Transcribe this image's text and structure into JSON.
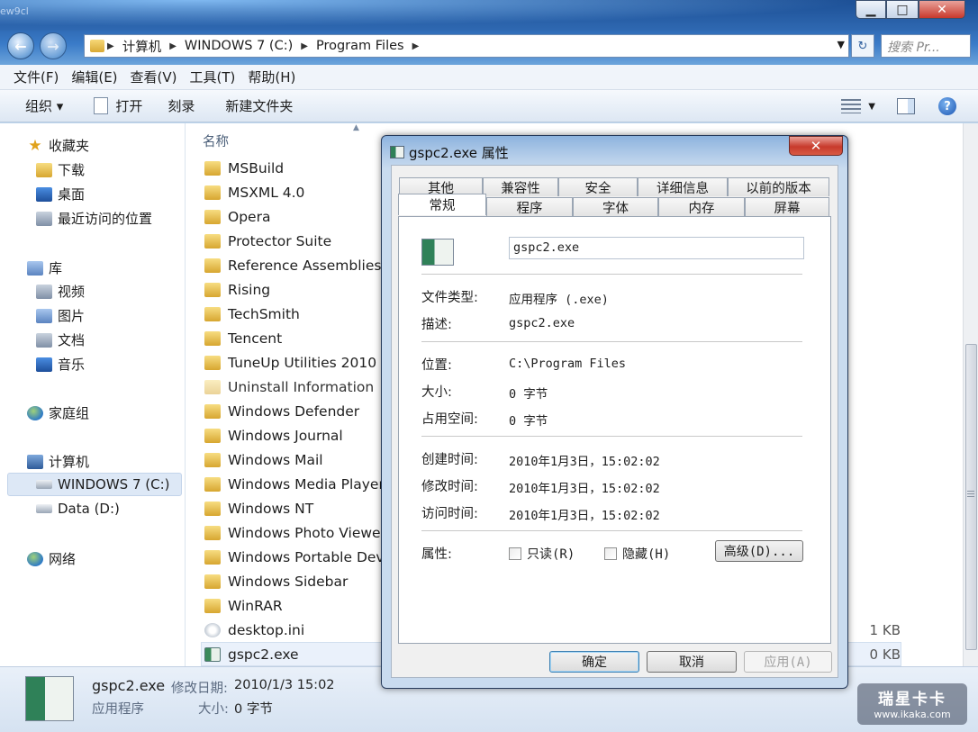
{
  "explorer": {
    "corner_text": "ew9cl",
    "caption": {
      "minimize": "▁",
      "maximize": "□",
      "close": "✕"
    },
    "breadcrumb": [
      "计算机",
      "WINDOWS 7 (C:)",
      "Program Files"
    ],
    "search_placeholder": "搜索 Pr...",
    "menu": [
      "文件(F)",
      "编辑(E)",
      "查看(V)",
      "工具(T)",
      "帮助(H)"
    ],
    "toolbar": {
      "organize": "组织 ▾",
      "open": "打开",
      "burn": "刻录",
      "new_folder": "新建文件夹",
      "help": "?"
    },
    "nav": {
      "favorites": "收藏夹",
      "downloads": "下载",
      "desktop": "桌面",
      "recent": "最近访问的位置",
      "libraries": "库",
      "videos": "视频",
      "pictures": "图片",
      "documents": "文档",
      "music": "音乐",
      "homegroup": "家庭组",
      "computer": "计算机",
      "drive_c": "WINDOWS 7 (C:)",
      "drive_d": "Data (D:)",
      "network": "网络"
    },
    "column_name": "名称",
    "files": [
      "MSBuild",
      "MSXML 4.0",
      "Opera",
      "Protector Suite",
      "Reference Assemblies",
      "Rising",
      "TechSmith",
      "Tencent",
      "TuneUp Utilities 2010",
      "Uninstall Information",
      "Windows Defender",
      "Windows Journal",
      "Windows Mail",
      "Windows Media Player",
      "Windows NT",
      "Windows Photo Viewer",
      "Windows Portable Devi",
      "Windows Sidebar",
      "WinRAR",
      "desktop.ini",
      "gspc2.exe"
    ],
    "sizes": {
      "desktop_ini": "1 KB",
      "gspc2_exe": "0 KB"
    },
    "details": {
      "name": "gspc2.exe",
      "modified_label": "修改日期:",
      "modified_value": "2010/1/3 15:02",
      "type": "应用程序",
      "size_label": "大小:",
      "size_value": "0 字节"
    },
    "watermark": {
      "line1": "瑞星卡卡",
      "line2": "www.ikaka.com"
    }
  },
  "dialog": {
    "title": "gspc2.exe 属性",
    "close": "✕",
    "tabs_back": [
      "其他",
      "兼容性",
      "安全",
      "详细信息",
      "以前的版本"
    ],
    "tabs_front": [
      "常规",
      "程序",
      "字体",
      "内存",
      "屏幕"
    ],
    "filename": "gspc2.exe",
    "file_type_label": "文件类型:",
    "file_type_value": "应用程序 (.exe)",
    "desc_label": "描述:",
    "desc_value": "gspc2.exe",
    "location_label": "位置:",
    "location_value": "C:\\Program Files",
    "size_label": "大小:",
    "size_value": "0 字节",
    "size_on_disk_label": "占用空间:",
    "size_on_disk_value": "0 字节",
    "created_label": "创建时间:",
    "created_value": "2010年1月3日，15:02:02",
    "modified_label": "修改时间:",
    "modified_value": "2010年1月3日，15:02:02",
    "accessed_label": "访问时间:",
    "accessed_value": "2010年1月3日，15:02:02",
    "attributes_label": "属性:",
    "readonly": "只读(R)",
    "hidden": "隐藏(H)",
    "advanced": "高级(D)...",
    "ok": "确定",
    "cancel": "取消",
    "apply": "应用(A)"
  }
}
